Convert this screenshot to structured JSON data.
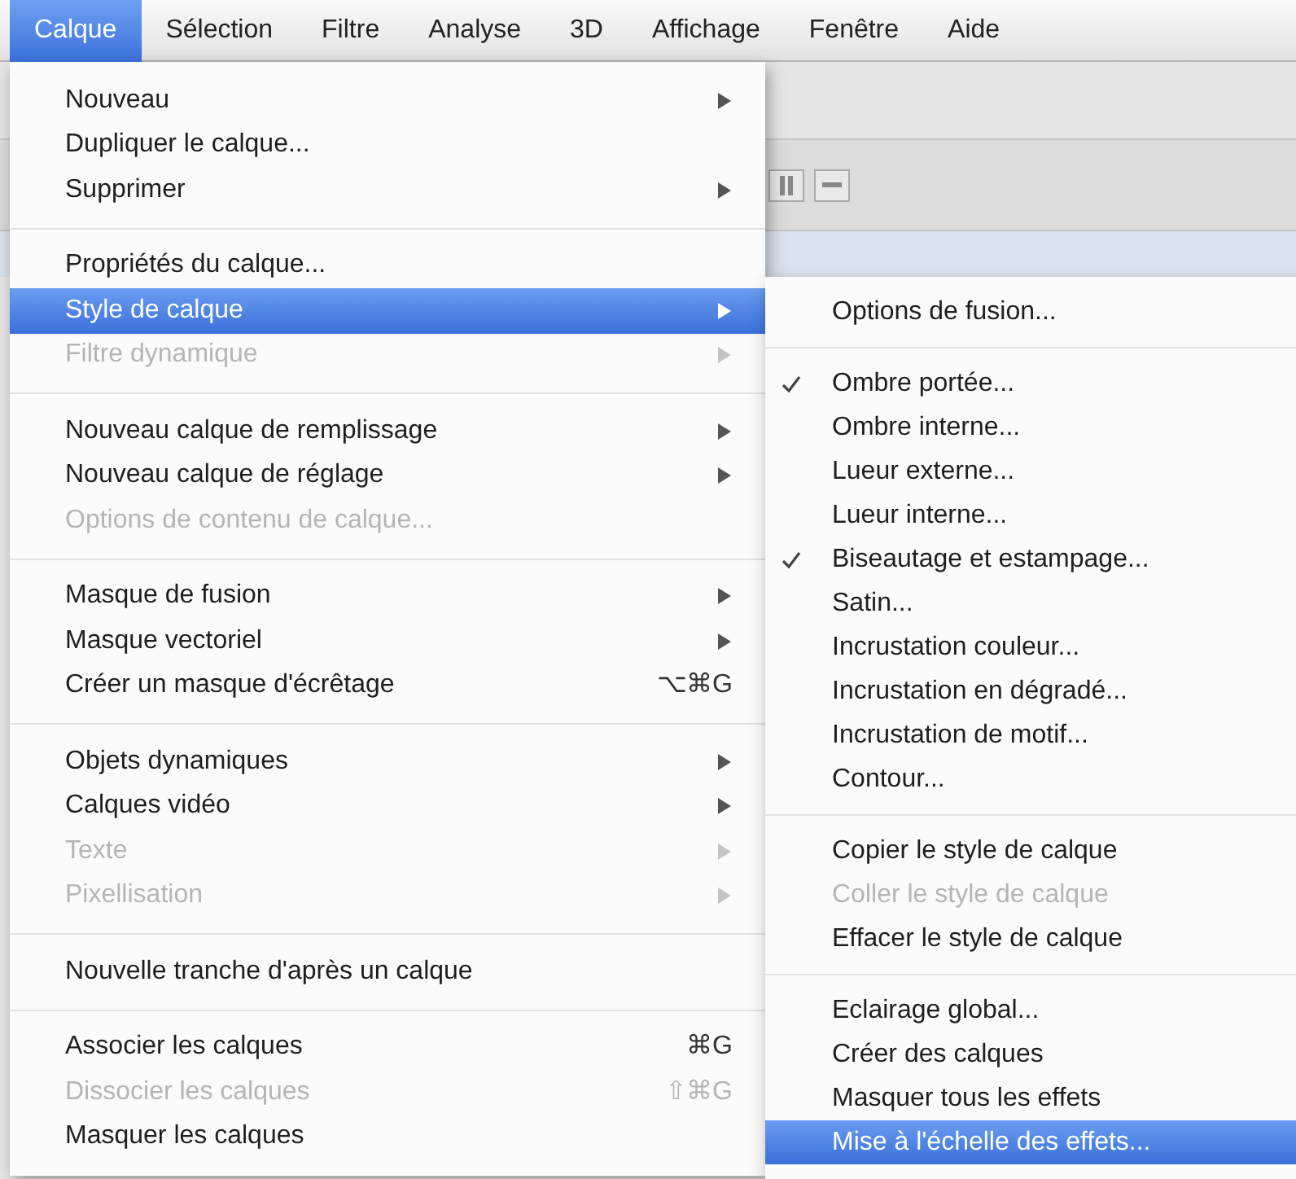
{
  "menubar": [
    {
      "label": "Calque",
      "selected": true
    },
    {
      "label": "Sélection",
      "selected": false
    },
    {
      "label": "Filtre",
      "selected": false
    },
    {
      "label": "Analyse",
      "selected": false
    },
    {
      "label": "3D",
      "selected": false
    },
    {
      "label": "Affichage",
      "selected": false
    },
    {
      "label": "Fenêtre",
      "selected": false
    },
    {
      "label": "Aide",
      "selected": false
    }
  ],
  "menu": {
    "groups": [
      {
        "items": [
          {
            "label": "Nouveau",
            "disabled": false,
            "selected": false,
            "has_submenu": true
          },
          {
            "label": "Dupliquer le calque...",
            "disabled": false,
            "selected": false,
            "has_submenu": false
          },
          {
            "label": "Supprimer",
            "disabled": false,
            "selected": false,
            "has_submenu": true
          }
        ]
      },
      {
        "items": [
          {
            "label": "Propriétés du calque...",
            "disabled": false,
            "selected": false,
            "has_submenu": false
          },
          {
            "label": "Style de calque",
            "disabled": false,
            "selected": true,
            "has_submenu": true
          },
          {
            "label": "Filtre dynamique",
            "disabled": true,
            "selected": false,
            "has_submenu": true
          }
        ]
      },
      {
        "items": [
          {
            "label": "Nouveau calque de remplissage",
            "disabled": false,
            "selected": false,
            "has_submenu": true
          },
          {
            "label": "Nouveau calque de réglage",
            "disabled": false,
            "selected": false,
            "has_submenu": true
          },
          {
            "label": "Options de contenu de calque...",
            "disabled": true,
            "selected": false,
            "has_submenu": false
          }
        ]
      },
      {
        "items": [
          {
            "label": "Masque de fusion",
            "disabled": false,
            "selected": false,
            "has_submenu": true
          },
          {
            "label": "Masque vectoriel",
            "disabled": false,
            "selected": false,
            "has_submenu": true
          },
          {
            "label": "Créer un masque d'écrêtage",
            "disabled": false,
            "selected": false,
            "has_submenu": false,
            "shortcut": "⌥⌘G"
          }
        ]
      },
      {
        "items": [
          {
            "label": "Objets dynamiques",
            "disabled": false,
            "selected": false,
            "has_submenu": true
          },
          {
            "label": "Calques vidéo",
            "disabled": false,
            "selected": false,
            "has_submenu": true
          },
          {
            "label": "Texte",
            "disabled": true,
            "selected": false,
            "has_submenu": true
          },
          {
            "label": "Pixellisation",
            "disabled": true,
            "selected": false,
            "has_submenu": true
          }
        ]
      },
      {
        "items": [
          {
            "label": "Nouvelle tranche d'après un calque",
            "disabled": false,
            "selected": false,
            "has_submenu": false
          }
        ]
      },
      {
        "items": [
          {
            "label": "Associer les calques",
            "disabled": false,
            "selected": false,
            "has_submenu": false,
            "shortcut": "⌘G"
          },
          {
            "label": "Dissocier les calques",
            "disabled": true,
            "selected": false,
            "has_submenu": false,
            "shortcut": "⇧⌘G"
          },
          {
            "label": "Masquer les calques",
            "disabled": false,
            "selected": false,
            "has_submenu": false
          }
        ]
      }
    ]
  },
  "submenu": {
    "groups": [
      {
        "items": [
          {
            "label": "Options de fusion...",
            "checked": false,
            "disabled": false,
            "selected": false
          }
        ]
      },
      {
        "items": [
          {
            "label": "Ombre portée...",
            "checked": true,
            "disabled": false,
            "selected": false
          },
          {
            "label": "Ombre interne...",
            "checked": false,
            "disabled": false,
            "selected": false
          },
          {
            "label": "Lueur externe...",
            "checked": false,
            "disabled": false,
            "selected": false
          },
          {
            "label": "Lueur interne...",
            "checked": false,
            "disabled": false,
            "selected": false
          },
          {
            "label": "Biseautage et estampage...",
            "checked": true,
            "disabled": false,
            "selected": false
          },
          {
            "label": "Satin...",
            "checked": false,
            "disabled": false,
            "selected": false
          },
          {
            "label": "Incrustation couleur...",
            "checked": false,
            "disabled": false,
            "selected": false
          },
          {
            "label": "Incrustation en dégradé...",
            "checked": false,
            "disabled": false,
            "selected": false
          },
          {
            "label": "Incrustation de motif...",
            "checked": false,
            "disabled": false,
            "selected": false
          },
          {
            "label": "Contour...",
            "checked": false,
            "disabled": false,
            "selected": false
          }
        ]
      },
      {
        "items": [
          {
            "label": "Copier le style de calque",
            "checked": false,
            "disabled": false,
            "selected": false
          },
          {
            "label": "Coller le style de calque",
            "checked": false,
            "disabled": true,
            "selected": false
          },
          {
            "label": "Effacer le style de calque",
            "checked": false,
            "disabled": false,
            "selected": false
          }
        ]
      },
      {
        "items": [
          {
            "label": "Eclairage global...",
            "checked": false,
            "disabled": false,
            "selected": false
          },
          {
            "label": "Créer des calques",
            "checked": false,
            "disabled": false,
            "selected": false
          },
          {
            "label": "Masquer tous les effets",
            "checked": false,
            "disabled": false,
            "selected": false
          },
          {
            "label": "Mise à l'échelle des effets...",
            "checked": false,
            "disabled": false,
            "selected": true
          }
        ]
      }
    ]
  }
}
